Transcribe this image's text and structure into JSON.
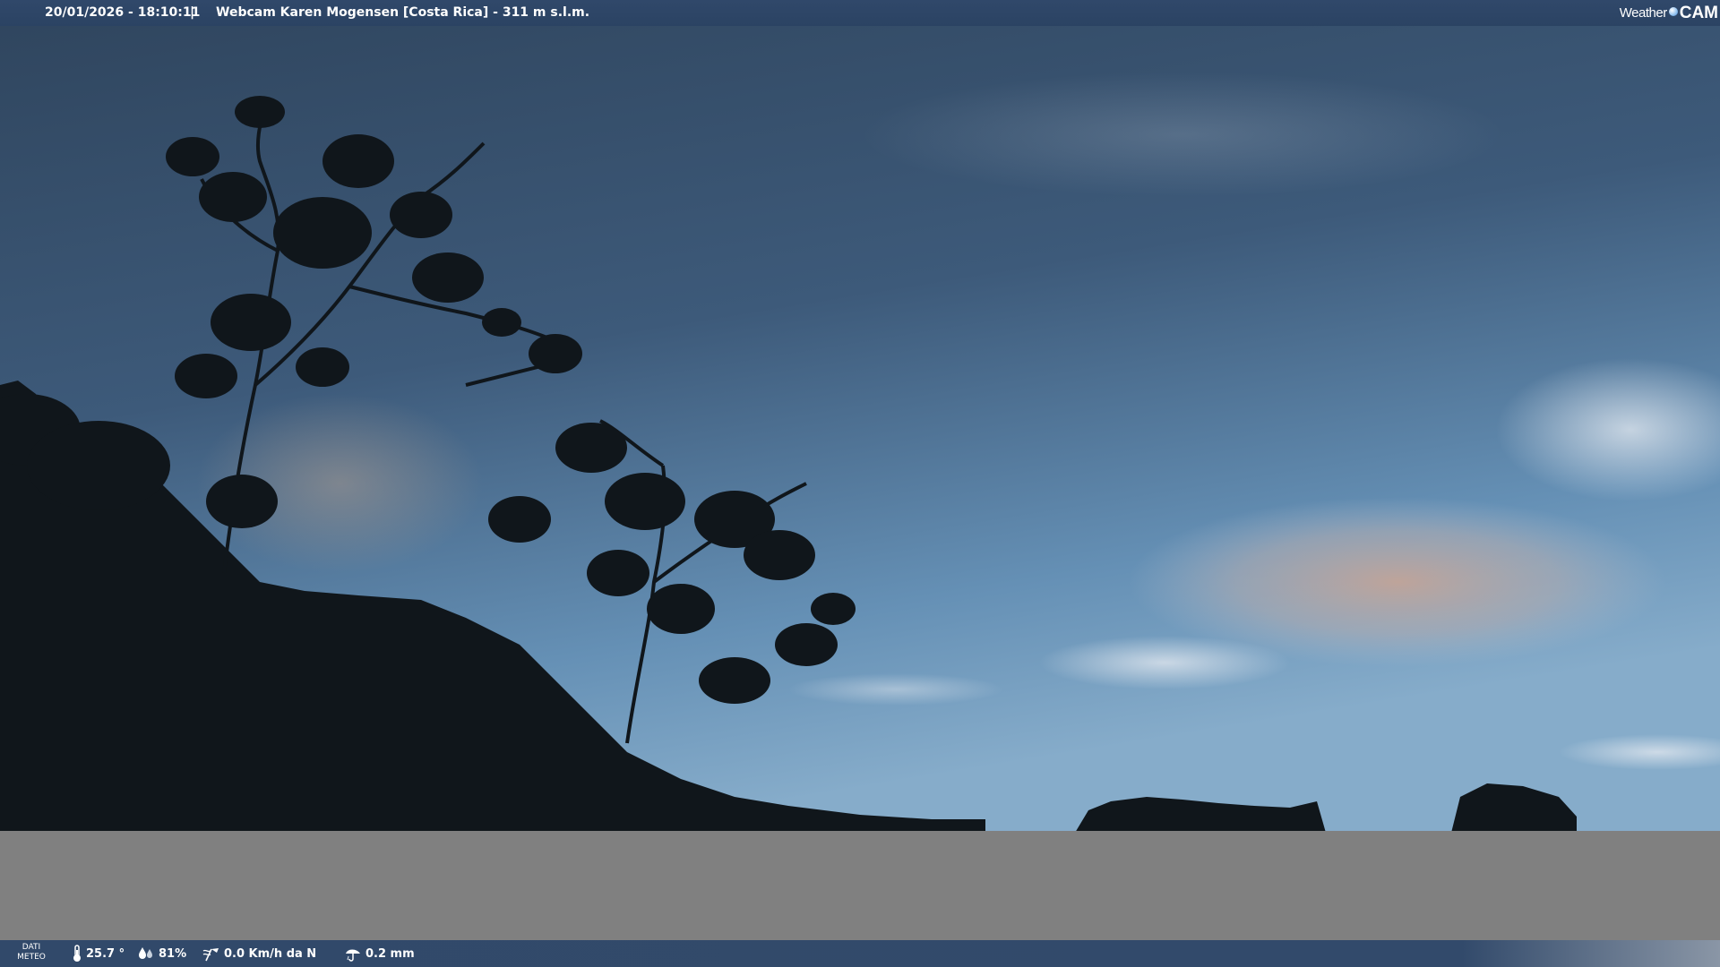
{
  "top_bar": {
    "timestamp": "20/01/2026 - 18:10:11",
    "separator": "|",
    "title": "Webcam Karen Mogensen [Costa Rica]  - 311 m s.l.m."
  },
  "logo": {
    "part1": "Weather",
    "part2": "CAM"
  },
  "bottom_bar": {
    "label_line1": "DATI",
    "label_line2": "METEO",
    "temperature": "25.7 °",
    "humidity": "81%",
    "wind": "0.0 Km/h da N",
    "rain": "0.2 mm"
  },
  "colors": {
    "bar_bg": "#2f4768",
    "sky_top": "#33496a",
    "sky_bottom": "#7aa4c6",
    "foliage": "#0f1418",
    "gray_band": "#808080"
  },
  "icons": {
    "temperature": "thermometer-icon",
    "humidity": "humidity-icon",
    "wind": "wind-icon",
    "rain": "rain-icon"
  }
}
